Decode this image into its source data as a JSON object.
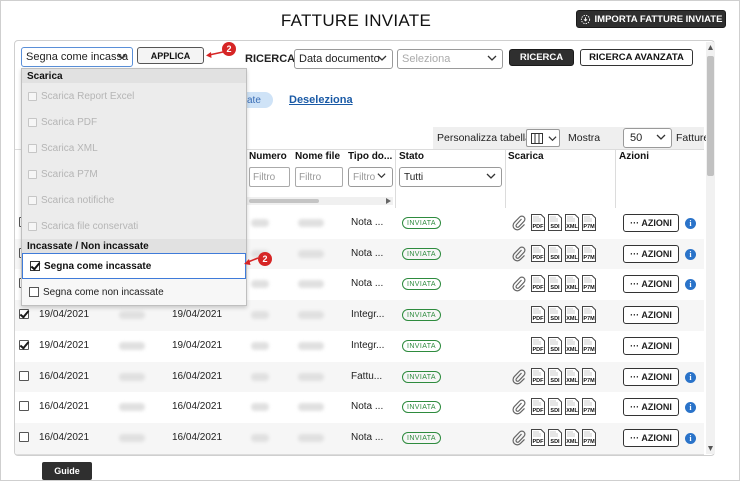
{
  "header": {
    "title": "FATTURE INVIATE",
    "import_button": "IMPORTA FATTURE INVIATE"
  },
  "toolbar": {
    "action_select": "Segna come incassa",
    "apply_button": "APPLICA",
    "search_label": "RICERCA",
    "date_select": "Data documento",
    "value_select_placeholder": "Seleziona",
    "search_button": "RICERCA",
    "advanced_search_button": "RICERCA AVANZATA",
    "marker_number": "2"
  },
  "selection": {
    "select_all_partial": "ate",
    "deselect_link": "Deseleziona"
  },
  "table_controls": {
    "customize_label": "Personalizza tabella",
    "show_label": "Mostra",
    "page_size": "50",
    "invoices_label": "Fatture"
  },
  "table": {
    "columns": [
      "Numero",
      "Nome file",
      "Tipo do...",
      "Stato",
      "Scarica",
      "Azioni"
    ],
    "filter_placeholder": "Filtro",
    "status_filter": "Tutti",
    "status_badge": "INVIATA",
    "actions_button": "··· AZIONI",
    "info_icon": "i",
    "file_icon_labels": [
      "PDF",
      "SDI",
      "XML",
      "P7M"
    ],
    "rows": [
      {
        "checked": false,
        "date1": "",
        "date2": "",
        "tipo": "Nota ...",
        "attachment": true
      },
      {
        "checked": false,
        "date1": "",
        "date2": "",
        "tipo": "Nota ...",
        "attachment": true
      },
      {
        "checked": false,
        "date1": "",
        "date2": "",
        "tipo": "Nota ...",
        "attachment": true
      },
      {
        "checked": true,
        "date1": "19/04/2021",
        "date2": "19/04/2021",
        "tipo": "Integr...",
        "attachment": false
      },
      {
        "checked": true,
        "date1": "19/04/2021",
        "date2": "19/04/2021",
        "tipo": "Integr...",
        "attachment": false
      },
      {
        "checked": false,
        "date1": "16/04/2021",
        "date2": "16/04/2021",
        "tipo": "Fattu...",
        "attachment": true
      },
      {
        "checked": false,
        "date1": "16/04/2021",
        "date2": "16/04/2021",
        "tipo": "Nota ...",
        "attachment": true
      },
      {
        "checked": false,
        "date1": "16/04/2021",
        "date2": "16/04/2021",
        "tipo": "Nota ...",
        "attachment": true
      }
    ]
  },
  "dropdown": {
    "group_download": "Scarica",
    "download_items": [
      "Scarica Report Excel",
      "Scarica PDF",
      "Scarica XML",
      "Scarica P7M",
      "Scarica notifiche",
      "Scarica file conservati"
    ],
    "group_paid": "Incassate / Non incassate",
    "paid_item": "Segna come incassate",
    "unpaid_item": "Segna come non incassate"
  },
  "footer": {
    "guide_button": "Guide"
  },
  "colors": {
    "dark_button": "#2f2f2f",
    "status_green": "#2e8b3e",
    "marker_red": "#d62525",
    "link_blue": "#1a5aa6",
    "info_blue": "#2a73c9"
  }
}
